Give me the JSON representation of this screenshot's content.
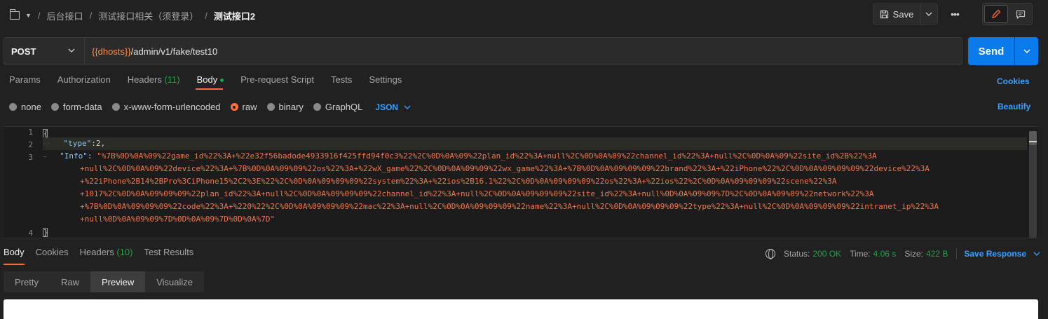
{
  "breadcrumb": {
    "items": [
      "后台接口",
      "测试接口相关（须登录）",
      "测试接口2"
    ],
    "separator": "/"
  },
  "toolbar": {
    "save_label": "Save",
    "more_label": "•••"
  },
  "request": {
    "method": "POST",
    "url_variable": "{{dhosts}}",
    "url_path": "/admin/v1/fake/test10",
    "send_label": "Send"
  },
  "request_tabs": {
    "params": "Params",
    "authorization": "Authorization",
    "headers": "Headers",
    "headers_count": "(11)",
    "body": "Body",
    "prerequest": "Pre-request Script",
    "tests": "Tests",
    "settings": "Settings",
    "cookies": "Cookies"
  },
  "body_types": {
    "none": "none",
    "form_data": "form-data",
    "urlencoded": "x-www-form-urlencoded",
    "raw": "raw",
    "binary": "binary",
    "graphql": "GraphQL",
    "format": "JSON",
    "beautify": "Beautify",
    "selected": "raw"
  },
  "editor": {
    "line_numbers": [
      "1",
      "2",
      "3",
      "4"
    ],
    "line1": "{",
    "key_type": "\"type\"",
    "val_type": "2,",
    "key_info": "\"Info\"",
    "info_lines": [
      "\"%7B%0D%0A%09%22game_id%22%3A+%22e32f56badode4933916f425ffd94f0c3%22%2C%0D%0A%09%22plan_id%22%3A+null%2C%0D%0A%09%22channel_id%22%3A+null%2C%0D%0A%09%22site_id%2B%22%3A",
      "+null%2C%0D%0A%09%22device%22%3A+%7B%0D%0A%09%09%22os%22%3A+%22wX_game%22%2C%0D%0A%09%09%22wx_game%22%3A+%7B%0D%0A%09%09%09%22brand%22%3A+%22iPhone%22%2C%0D%0A%09%09%09%22device%22%3A",
      "+%22iPhone%2B14%2BPro%3CiPhone15%2C2%3E%22%2C%0D%0A%09%09%09%22system%22%3A+%22ios%2B16.1%22%2C%0D%0A%09%09%09%22os%22%3A+%22ios%22%2C%0D%0A%09%09%09%22scene%22%3A",
      "+1017%2C%0D%0A%09%09%09%22plan_id%22%3A+null%2C%0D%0A%09%09%09%22channel_id%22%3A+null%2C%0D%0A%09%09%09%22site_id%22%3A+null%0D%0A%09%09%7D%2C%0D%0A%09%09%22network%22%3A",
      "+%7B%0D%0A%09%09%09%22code%22%3A+%220%22%2C%0D%0A%09%09%09%22mac%22%3A+null%2C%0D%0A%09%09%09%22name%22%3A+null%2C%0D%0A%09%09%09%22type%22%3A+null%2C%0D%0A%09%09%09%22intranet_ip%22%3A",
      "+null%0D%0A%09%09%7D%0D%0A%09%7D%0D%0A%7D\""
    ],
    "line4": "}"
  },
  "response": {
    "tabs": {
      "body": "Body",
      "cookies": "Cookies",
      "headers": "Headers",
      "headers_count": "(10)",
      "test_results": "Test Results"
    },
    "status_label": "Status:",
    "status_value": "200 OK",
    "time_label": "Time:",
    "time_value": "4.06 s",
    "size_label": "Size:",
    "size_value": "422 B",
    "save_response": "Save Response",
    "view_tabs": {
      "pretty": "Pretty",
      "raw": "Raw",
      "preview": "Preview",
      "visualize": "Visualize"
    }
  },
  "colors": {
    "accent_orange": "#ff6c37",
    "link_blue": "#3aa0ff",
    "send_blue": "#097bed",
    "success_green": "#1ea446",
    "json_key": "#8cc4f7",
    "json_string": "#f0784d"
  }
}
